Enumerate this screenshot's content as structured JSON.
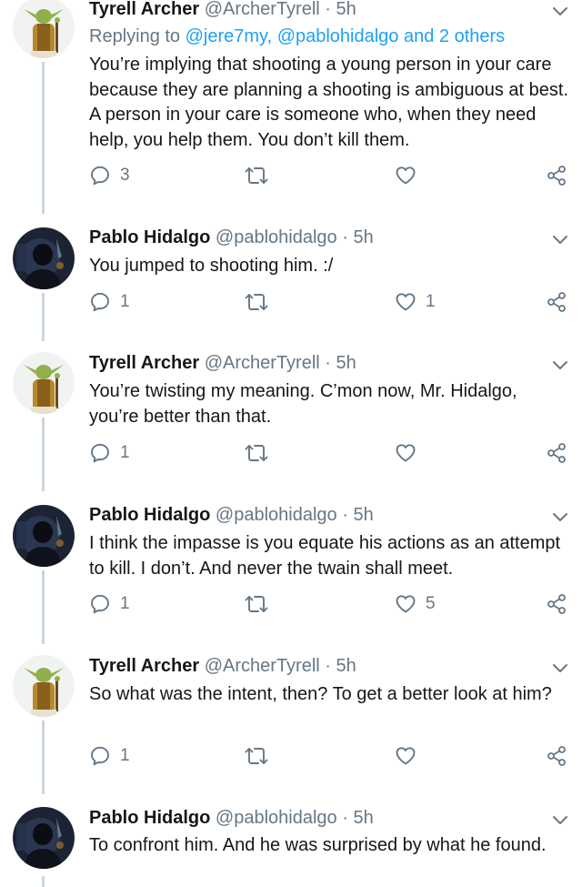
{
  "tweets": [
    {
      "name": "Tyrell Archer",
      "handle": "@ArcherTyrell",
      "sep": "·",
      "time": "5h",
      "reply_prefix": "Replying to ",
      "reply_links": "@jere7my, @pablohidalgo and 2 others",
      "text": "You’re implying that shooting a young person in your care because they are planning a shooting is ambiguous at best. A person in your care is someone who, when they need help, you help them. You don’t kill them.",
      "reply_count": "3",
      "retweet_count": "",
      "like_count": ""
    },
    {
      "name": "Pablo Hidalgo",
      "handle": "@pablohidalgo",
      "sep": "·",
      "time": "5h",
      "text": "You jumped to shooting him. :/",
      "reply_count": "1",
      "retweet_count": "",
      "like_count": "1"
    },
    {
      "name": "Tyrell Archer",
      "handle": "@ArcherTyrell",
      "sep": "·",
      "time": "5h",
      "text": "You’re twisting my meaning. C’mon now, Mr. Hidalgo, you’re better than that.",
      "reply_count": "1",
      "retweet_count": "",
      "like_count": ""
    },
    {
      "name": "Pablo Hidalgo",
      "handle": "@pablohidalgo",
      "sep": "·",
      "time": "5h",
      "text": "I think the impasse is you equate his actions as an attempt to kill. I don’t. And never the twain shall meet.",
      "reply_count": "1",
      "retweet_count": "",
      "like_count": "5"
    },
    {
      "name": "Tyrell Archer",
      "handle": "@ArcherTyrell",
      "sep": "·",
      "time": "5h",
      "text": "So what was the intent, then? To get a better look at him?",
      "reply_count": "1",
      "retweet_count": "",
      "like_count": ""
    },
    {
      "name": "Pablo Hidalgo",
      "handle": "@pablohidalgo",
      "sep": "·",
      "time": "5h",
      "text": "To confront him. And he was surprised by what he found."
    }
  ],
  "colors": {
    "text": "#14171a",
    "secondary": "#657786",
    "link": "#1da1f2",
    "thread_line": "#ccd6dd"
  },
  "icons": {
    "reply": "reply-icon",
    "retweet": "retweet-icon",
    "like": "heart-icon",
    "share": "share-icon",
    "menu": "chevron-down-icon"
  }
}
